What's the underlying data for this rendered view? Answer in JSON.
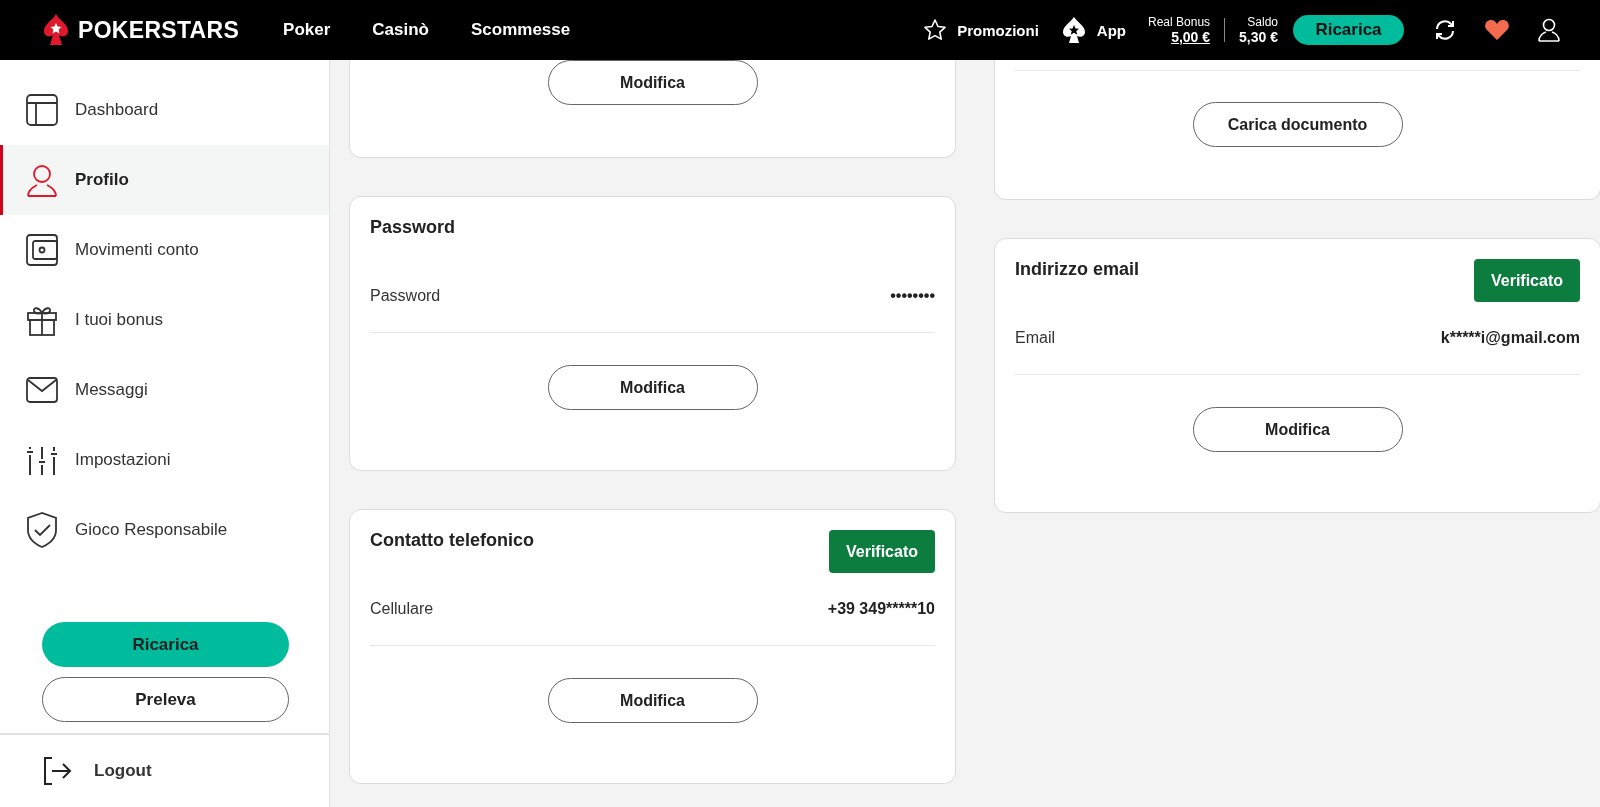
{
  "header": {
    "logo": "POKERSTARS",
    "nav": [
      {
        "label": "Poker"
      },
      {
        "label": "Casinò"
      },
      {
        "label": "Scommesse"
      }
    ],
    "links": [
      {
        "label": "Promozioni",
        "kind": "star"
      },
      {
        "label": "App",
        "kind": "spade"
      }
    ],
    "balances": [
      {
        "label": "Real Bonus",
        "value": "5,00 €",
        "linked": true
      },
      {
        "label": "Saldo",
        "value": "5,30 €",
        "linked": false
      }
    ],
    "deposit": "Ricarica"
  },
  "sidebar": {
    "items": [
      {
        "label": "Dashboard",
        "kind": "layout",
        "selected": false
      },
      {
        "label": "Profilo",
        "kind": "user",
        "selected": true
      },
      {
        "label": "Movimenti conto",
        "kind": "wallet",
        "selected": false
      },
      {
        "label": "I tuoi bonus",
        "kind": "gift",
        "selected": false
      },
      {
        "label": "Messaggi",
        "kind": "mail",
        "selected": false
      },
      {
        "label": "Impostazioni",
        "kind": "sliders",
        "selected": false
      },
      {
        "label": "Gioco Responsabile",
        "kind": "shield",
        "selected": false
      }
    ],
    "buttons": [
      {
        "label": "Ricarica",
        "kind": "primary"
      },
      {
        "label": "Preleva",
        "kind": "outline"
      }
    ],
    "logout": "Logout"
  },
  "columns": [
    [
      {
        "cut_top": true,
        "top_rule": false,
        "button": "Modifica"
      },
      {
        "title": "Password",
        "rows": [
          {
            "label": "Password",
            "value": "••••••••"
          }
        ],
        "button": "Modifica"
      },
      {
        "title": "Contatto telefonico",
        "badge": "Verificato",
        "rows": [
          {
            "label": "Cellulare",
            "value": "+39 349*****10"
          }
        ],
        "button": "Modifica"
      }
    ],
    [
      {
        "cut_top": true,
        "top_rule": true,
        "button": "Carica documento"
      },
      {
        "title": "Indirizzo email",
        "badge": "Verificato",
        "rows": [
          {
            "label": "Email",
            "value": "k*****i@gmail.com"
          }
        ],
        "button": "Modifica"
      }
    ]
  ]
}
